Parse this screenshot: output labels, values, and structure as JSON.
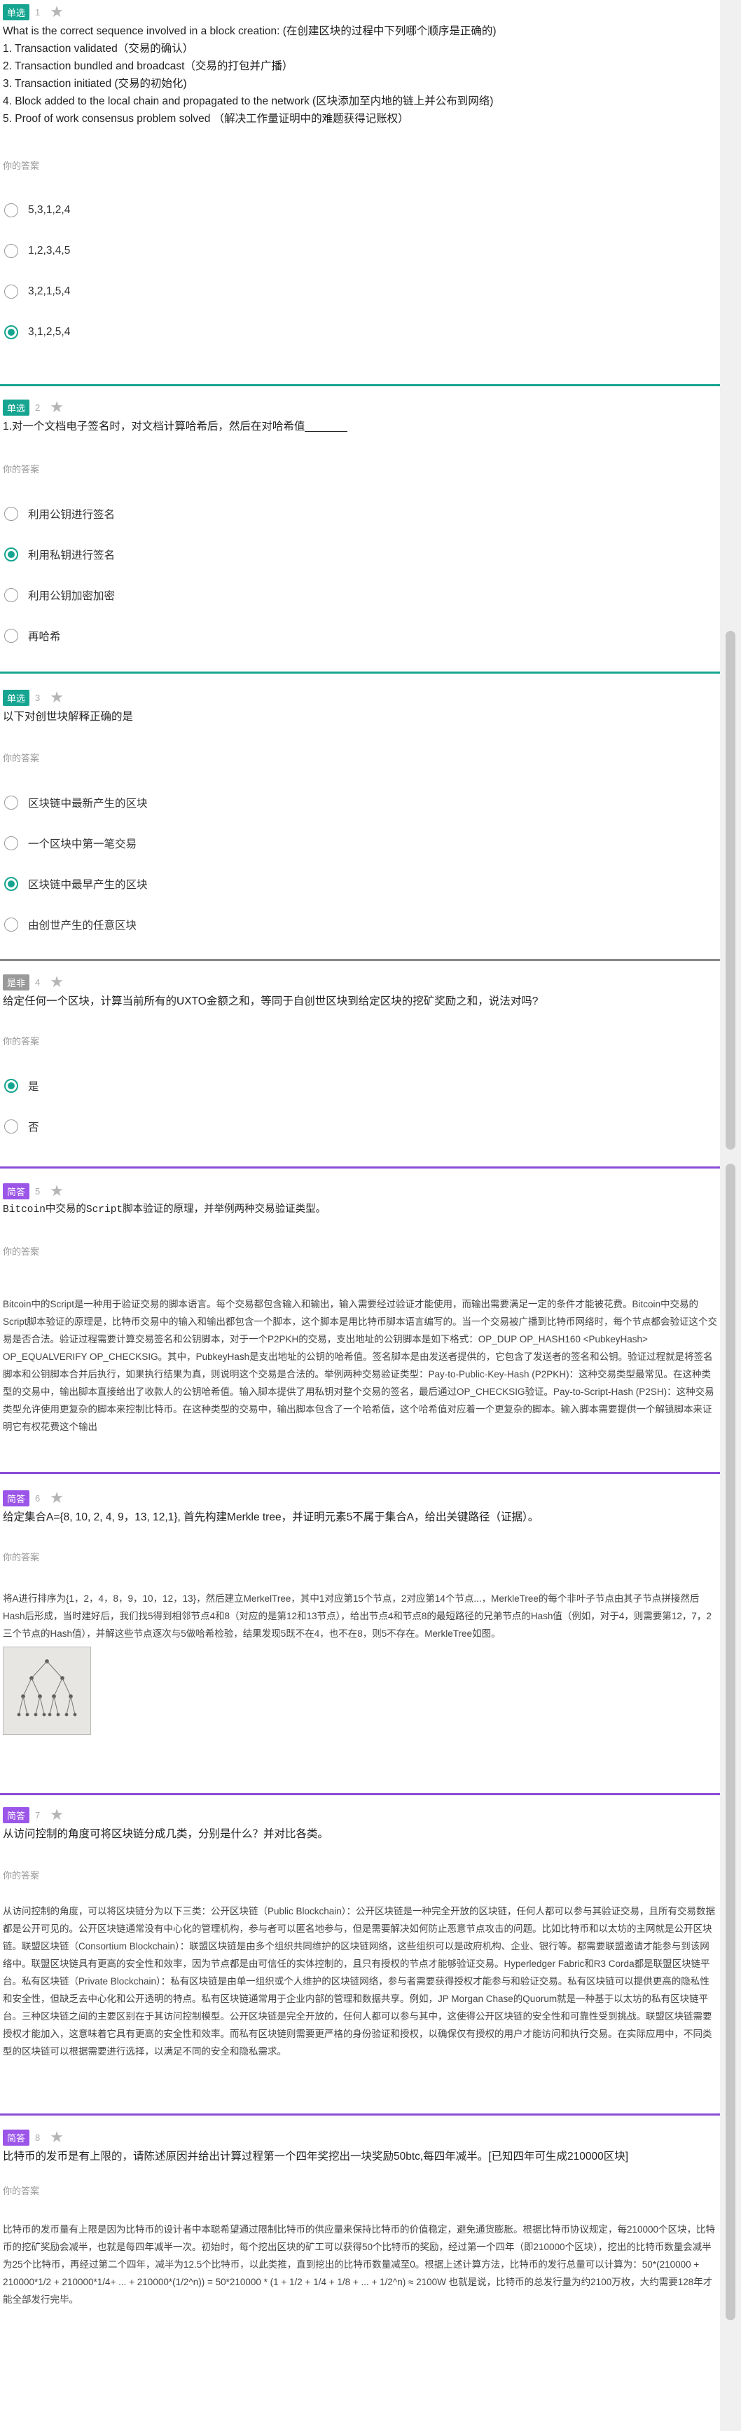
{
  "colors": {
    "teal": "#16a590",
    "purple": "#8a4bd6",
    "gray": "#9a9a9a",
    "tag_single": "#16a590",
    "tag_judge": "#9a9a9a",
    "tag_essay": "#9b55e8"
  },
  "answer_label": "你的答案",
  "q1": {
    "tag": "单选",
    "num": "1",
    "stem": [
      "What is the correct sequence involved in a block creation:     (在创建区块的过程中下列哪个顺序是正确的)",
      "1. Transaction validated（交易的确认）",
      "2. Transaction bundled and broadcast（交易的打包并广播）",
      "3. Transaction initiated (交易的初始化)",
      "4. Block added to the local chain and propagated to the network (区块添加至内地的链上并公布到网络)",
      "5. Proof of work consensus problem solved  （解决工作量证明中的难题获得记账权）"
    ],
    "options": [
      "5,3,1,2,4",
      "1,2,3,4,5",
      "3,2,1,5,4",
      "3,1,2,5,4"
    ],
    "selected": 3
  },
  "q2": {
    "tag": "单选",
    "num": "2",
    "stem": "1.对一个文档电子签名时，对文档计算哈希后，然后在对哈希值_______",
    "options": [
      "利用公钥进行签名",
      "利用私钥进行签名",
      "利用公钥加密加密",
      "再哈希"
    ],
    "selected": 1
  },
  "q3": {
    "tag": "单选",
    "num": "3",
    "stem": "以下对创世块解释正确的是",
    "options": [
      "区块链中最新产生的区块",
      "一个区块中第一笔交易",
      "区块链中最早产生的区块",
      "由创世产生的任意区块"
    ],
    "selected": 2
  },
  "q4": {
    "tag": "是非",
    "num": "4",
    "stem": "给定任何一个区块，计算当前所有的UXTO金额之和，等同于自创世区块到给定区块的挖矿奖励之和，说法对吗?",
    "options": [
      "是",
      "否"
    ],
    "selected": 0
  },
  "q5": {
    "tag": "简答",
    "num": "5",
    "stem": "Bitcoin中交易的Script脚本验证的原理，并举例两种交易验证类型。",
    "answer": "Bitcoin中的Script是一种用于验证交易的脚本语言。每个交易都包含输入和输出，输入需要经过验证才能使用，而输出需要满足一定的条件才能被花费。Bitcoin中交易的Script脚本验证的原理是，比特币交易中的输入和输出都包含一个脚本，这个脚本是用比特币脚本语言编写的。当一个交易被广播到比特币网络时，每个节点都会验证这个交易是否合法。验证过程需要计算交易签名和公钥脚本，对于一个P2PKH的交易，支出地址的公钥脚本是如下格式：OP_DUP OP_HASH160 <PubkeyHash> OP_EQUALVERIFY OP_CHECKSIG。其中，PubkeyHash是支出地址的公钥的哈希值。签名脚本是由发送者提供的，它包含了发送者的签名和公钥。验证过程就是将签名脚本和公钥脚本合并后执行，如果执行结果为真，则说明这个交易是合法的。举例两种交易验证类型：Pay-to-Public-Key-Hash (P2PKH)：这种交易类型最常见。在这种类型的交易中，输出脚本直接给出了收款人的公钥哈希值。输入脚本提供了用私钥对整个交易的签名，最后通过OP_CHECKSIG验证。Pay-to-Script-Hash (P2SH)：这种交易类型允许使用更复杂的脚本来控制比特币。在这种类型的交易中，输出脚本包含了一个哈希值，这个哈希值对应着一个更复杂的脚本。输入脚本需要提供一个解锁脚本来证明它有权花费这个输出"
  },
  "q6": {
    "tag": "简答",
    "num": "6",
    "stem": "给定集合A={8, 10, 2, 4, 9，13, 12,1}, 首先构建Merkle tree，并证明元素5不属于集合A，给出关键路径（证据）。",
    "answer": "将A进行排序为{1，2，4，8，9，10，12，13}，然后建立MerkelTree，其中1对应第15个节点，2对应第14个节点...，MerkleTree的每个非叶子节点由其子节点拼接然后Hash后形成，当时建好后，我们找5得到相邻节点4和8（对应的是第12和13节点），给出节点4和节点8的最短路径的兄弟节点的Hash值（例如，对于4，则需要第12，7，2三个节点的Hash值），并解这些节点逐次与5做哈希检验，结果发现5既不在4，也不在8，则5不存在。MerkleTree如图。"
  },
  "q7": {
    "tag": "简答",
    "num": "7",
    "stem": "从访问控制的角度可将区块链分成几类，分别是什么？并对比各类。",
    "answer": "从访问控制的角度，可以将区块链分为以下三类：公开区块链（Public Blockchain）：公开区块链是一种完全开放的区块链，任何人都可以参与其验证交易，且所有交易数据都是公开可见的。公开区块链通常没有中心化的管理机构，参与者可以匿名地参与，但是需要解决如何防止恶意节点攻击的问题。比如比特币和以太坊的主网就是公开区块链。联盟区块链（Consortium Blockchain）：联盟区块链是由多个组织共同维护的区块链网络，这些组织可以是政府机构、企业、银行等。都需要联盟邀请才能参与到该网络中。联盟区块链具有更高的安全性和效率，因为节点都是由可信任的实体控制的，且只有授权的节点才能够验证交易。Hyperledger Fabric和R3 Corda都是联盟区块链平台。私有区块链（Private Blockchain）：私有区块链是由单一组织或个人维护的区块链网络，参与者需要获得授权才能参与和验证交易。私有区块链可以提供更高的隐私性和安全性，但缺乏去中心化和公开透明的特点。私有区块链通常用于企业内部的管理和数据共享。例如，JP Morgan Chase的Quorum就是一种基于以太坊的私有区块链平台。三种区块链之间的主要区别在于其访问控制模型。公开区块链是完全开放的，任何人都可以参与其中，这使得公开区块链的安全性和可靠性受到挑战。联盟区块链需要授权才能加入，这意味着它具有更高的安全性和效率。而私有区块链则需要更严格的身份验证和授权，以确保仅有授权的用户才能访问和执行交易。在实际应用中，不同类型的区块链可以根据需要进行选择，以满足不同的安全和隐私需求。"
  },
  "q8": {
    "tag": "简答",
    "num": "8",
    "stem": "比特币的发币是有上限的，请陈述原因并给出计算过程第一个四年奖挖出一块奖励50btc,每四年减半。[已知四年可生成210000区块]",
    "answer": "比特币的发币量有上限是因为比特币的设计者中本聪希望通过限制比特币的供应量来保持比特币的价值稳定，避免通货膨胀。根据比特币协议规定，每210000个区块，比特币的挖矿奖励会减半，也就是每四年减半一次。初始时，每个挖出区块的矿工可以获得50个比特币的奖励，经过第一个四年（即210000个区块），挖出的比特币数量会减半为25个比特币，再经过第二个四年，减半为12.5个比特币，以此类推，直到挖出的比特币数量减至0。根据上述计算方法，比特币的发行总量可以计算为：50*(210000 + 210000*1/2 + 210000*1/4+ ... + 210000*(1/2^n)) = 50*210000 * (1 + 1/2 + 1/4 + 1/8 + ... + 1/2^n) ≈ 2100W 也就是说，比特币的总发行量为约2100万枚，大约需要128年才能全部发行完毕。"
  }
}
